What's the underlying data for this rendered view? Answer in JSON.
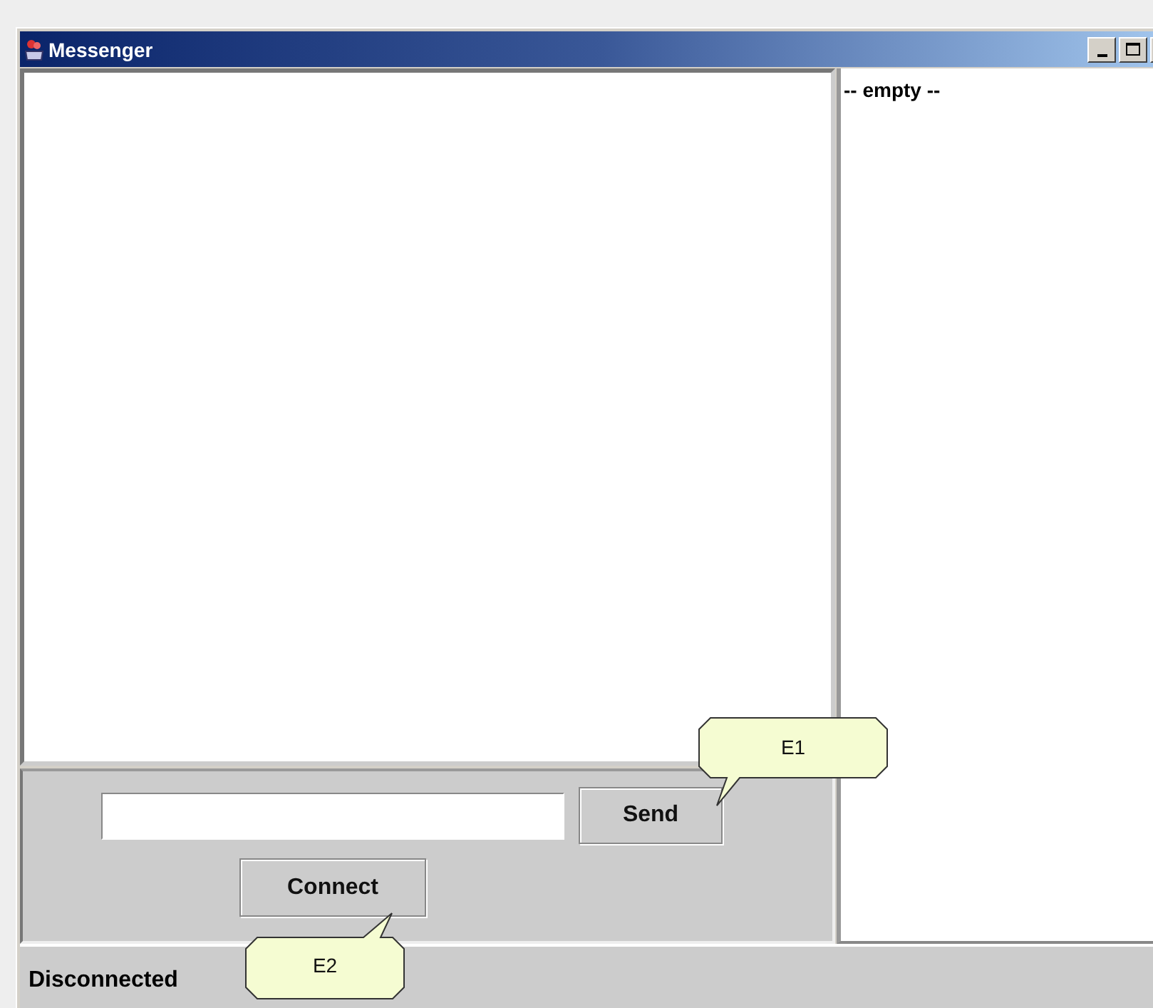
{
  "window": {
    "title": "Messenger"
  },
  "buttons": [
    {
      "kind": "send",
      "label": "Send"
    },
    {
      "kind": "connect",
      "label": "Connect"
    }
  ],
  "contacts": {
    "items": [
      "-- empty --"
    ]
  },
  "status_bar": {
    "text": "Disconnected"
  },
  "callouts": [
    {
      "kind": "send",
      "label": "E1"
    },
    {
      "kind": "connect",
      "label": "E2"
    }
  ]
}
